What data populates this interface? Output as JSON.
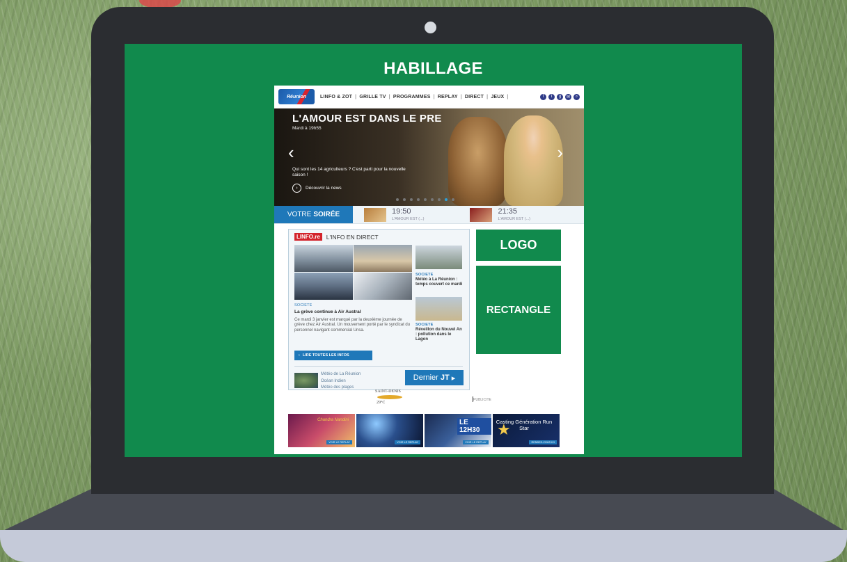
{
  "screen": {
    "label": "HABILLAGE"
  },
  "placeholders": {
    "logo": "LOGO",
    "rectangle": "RECTANGLE"
  },
  "site": {
    "logo_text": "Réunion",
    "nav": [
      "LINFO & ZOT",
      "GRILLE TV",
      "PROGRAMMES",
      "REPLAY",
      "DIRECT",
      "JEUX"
    ],
    "hero": {
      "title": "L'AMOUR EST DANS LE PRE",
      "subtitle": "Mardi à 19h55",
      "text": "Qui sont les 14 agriculteurs ? C'est parti pour la nouvelle saison !",
      "cta": "Découvrir la news",
      "slides": 9,
      "active_slide": 7
    },
    "soiree": {
      "label_prefix": "VOTRE",
      "label_bold": "SOIRÉE",
      "slots": [
        {
          "time": "19:50",
          "title": "L'AMOUR EST (...)"
        },
        {
          "time": "21:35",
          "title": "L'AMOUR EST (...)"
        }
      ]
    },
    "info": {
      "logo": "LINFO.re",
      "title": "L'INFO EN DIRECT",
      "main_category": "SOCIETE",
      "main_headline": "La grève continue à Air Austral",
      "main_text": "Ce mardi 3 janvier est marqué par la deuxième journée de grève chez Air Austral. Un mouvement porté par le syndicat du personnel navigant commercial Unsa.",
      "side1_category": "SOCIETE",
      "side1_text": "Météo à La Réunion : temps couvert ce mardi",
      "side2_category": "SOCIETE",
      "side2_text": "Réveillon du Nouvel An : pollution dans le Lagon",
      "read_all": "LIRE TOUTES LES INFOS",
      "meteo_links": [
        "Météo de La Réunion",
        "Océan Indien",
        "Météo des plages"
      ],
      "dernier_prefix": "Dernier",
      "dernier_bold": "JT",
      "weather_city": "SAINT-DENIS",
      "weather_temp": "29°C",
      "pub": "PUBLICITE"
    },
    "banners": [
      {
        "tag": "",
        "corner": "Chandra Nandini",
        "mini": "VOIR LE REPLAY"
      },
      {
        "tag": "",
        "corner": "",
        "mini": "VOIR LE REPLAY"
      },
      {
        "tag": "LE 12H30",
        "corner": "",
        "mini": "VOIR LE REPLAY"
      },
      {
        "tag": "",
        "corner": "",
        "casting": "Casting Génération Run Star",
        "mini": "RENDEZ-VOUS ICI"
      }
    ]
  }
}
